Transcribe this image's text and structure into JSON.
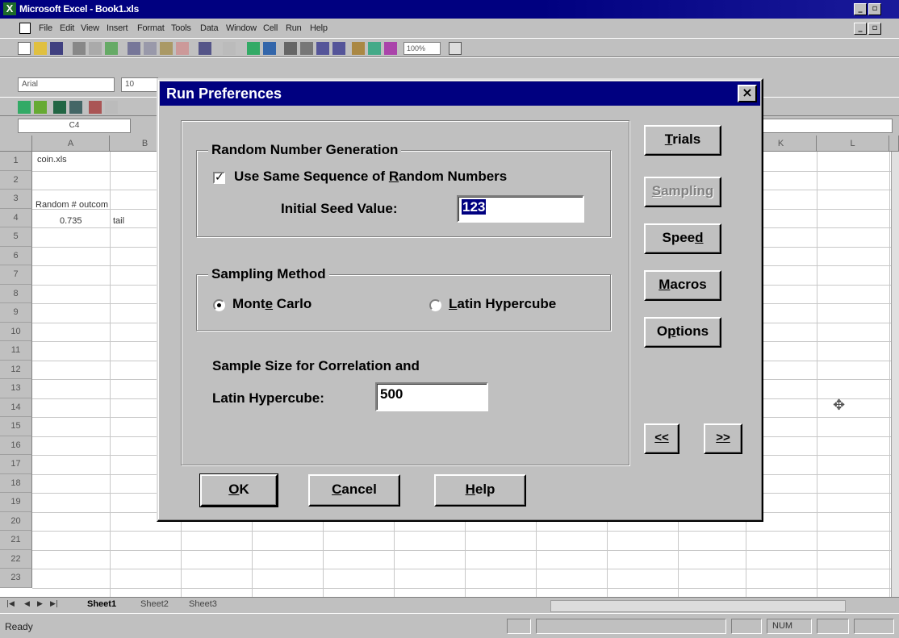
{
  "excel": {
    "title": "Microsoft Excel - Book1.xls",
    "menu": [
      "File",
      "Edit",
      "View",
      "Insert",
      "Format",
      "Tools",
      "Data",
      "Window",
      "Cell",
      "Run",
      "Help"
    ],
    "zoom": "100%",
    "font_name": "Arial",
    "font_size": "10",
    "name_box": "C4",
    "columns": [
      "A",
      "B",
      "K",
      "L"
    ],
    "rows": [
      "1",
      "2",
      "3",
      "4",
      "5",
      "6",
      "7",
      "8",
      "9",
      "10",
      "11",
      "12",
      "13",
      "14",
      "15",
      "16",
      "17",
      "18",
      "19",
      "20",
      "21",
      "22",
      "23"
    ],
    "cells": {
      "a1": "coin.xls",
      "a3": "Random #",
      "b3": "outcom",
      "a4": "0.735",
      "b4": "tail"
    },
    "sheets": [
      "Sheet1",
      "Sheet2",
      "Sheet3"
    ],
    "status_text": "Ready",
    "status_num": "NUM"
  },
  "dialog": {
    "title": "Run Preferences",
    "close_glyph": "×",
    "rng_group": "Random Number Generation",
    "use_same_seq": "Use Same Sequence of Random Numbers",
    "use_same_seq_checked": true,
    "seed_label": "Initial Seed Value:",
    "seed_value": "123",
    "sampling_group": "Sampling Method",
    "monte_carlo": "Monte Carlo",
    "latin_hypercube": "Latin Hypercube",
    "sampling_selected": "Monte Carlo",
    "sample_size_line1": "Sample Size for Correlation and",
    "sample_size_line2": "Latin Hypercube:",
    "sample_size_value": "500",
    "buttons": {
      "trials": "Trials",
      "sampling": "Sampling",
      "speed": "Speed",
      "macros": "Macros",
      "options": "Options",
      "prev": "<<",
      "next": ">>",
      "ok": "OK",
      "cancel": "Cancel",
      "help": "Help"
    }
  }
}
